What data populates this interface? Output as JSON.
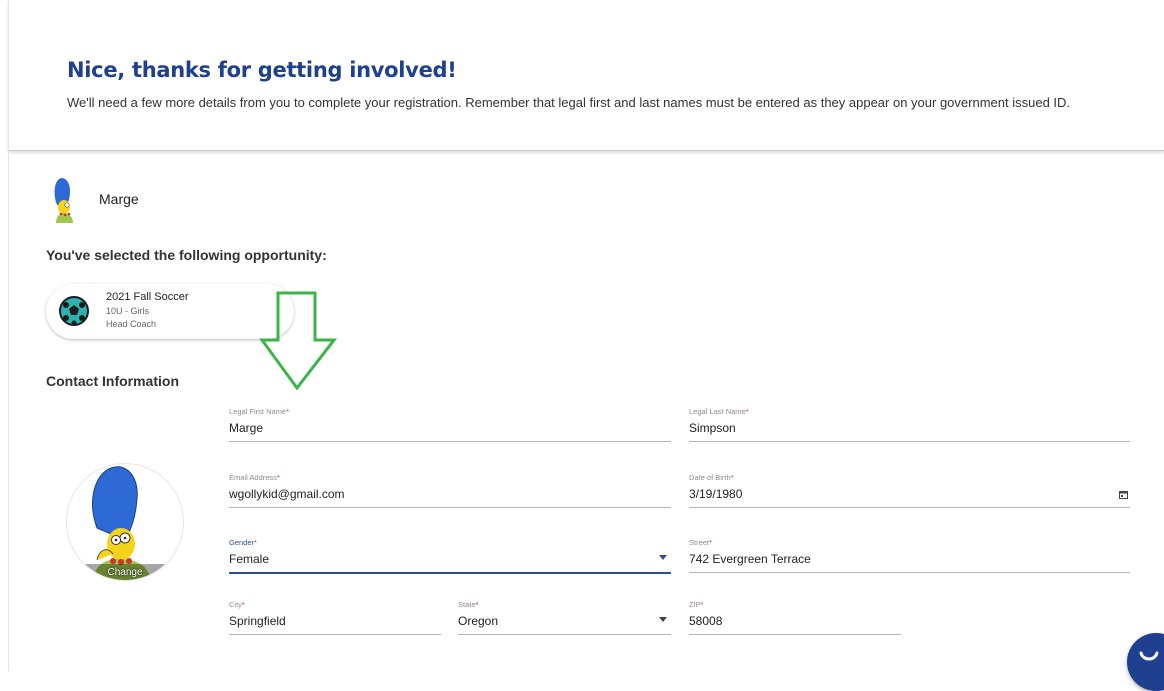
{
  "header": {
    "title": "Nice, thanks for getting involved!",
    "intro": "We'll need a few more details from you to complete your registration. Remember that legal first and last names must be entered as they appear on your government issued ID."
  },
  "user": {
    "name": "Marge"
  },
  "opportunity": {
    "heading": "You've selected the following opportunity:",
    "title": "2021 Fall Soccer",
    "division": "10U - Girls",
    "role": "Head Coach",
    "icon": "soccer-ball-icon"
  },
  "contact": {
    "heading": "Contact Information",
    "photo_change_label": "Change",
    "required_mark": "*",
    "fields": {
      "first_name": {
        "label": "Legal First Name",
        "value": "Marge"
      },
      "last_name": {
        "label": "Legal Last Name",
        "value": "Simpson"
      },
      "email": {
        "label": "Email Address",
        "value": "wgollykid@gmail.com"
      },
      "dob": {
        "label": "Date of Birth",
        "value": "3/19/1980"
      },
      "gender": {
        "label": "Gender",
        "value": "Female"
      },
      "street": {
        "label": "Street",
        "value": "742 Evergreen Terrace"
      },
      "city": {
        "label": "City",
        "value": "Springfield"
      },
      "state": {
        "label": "State",
        "value": "Oregon"
      },
      "zip": {
        "label": "ZIP",
        "value": "58008"
      }
    }
  },
  "colors": {
    "brand_blue": "#1f3f8f",
    "focus_blue": "#2f4b9a",
    "annotation_green": "#3cb44b",
    "required_red": "#c0392b"
  }
}
